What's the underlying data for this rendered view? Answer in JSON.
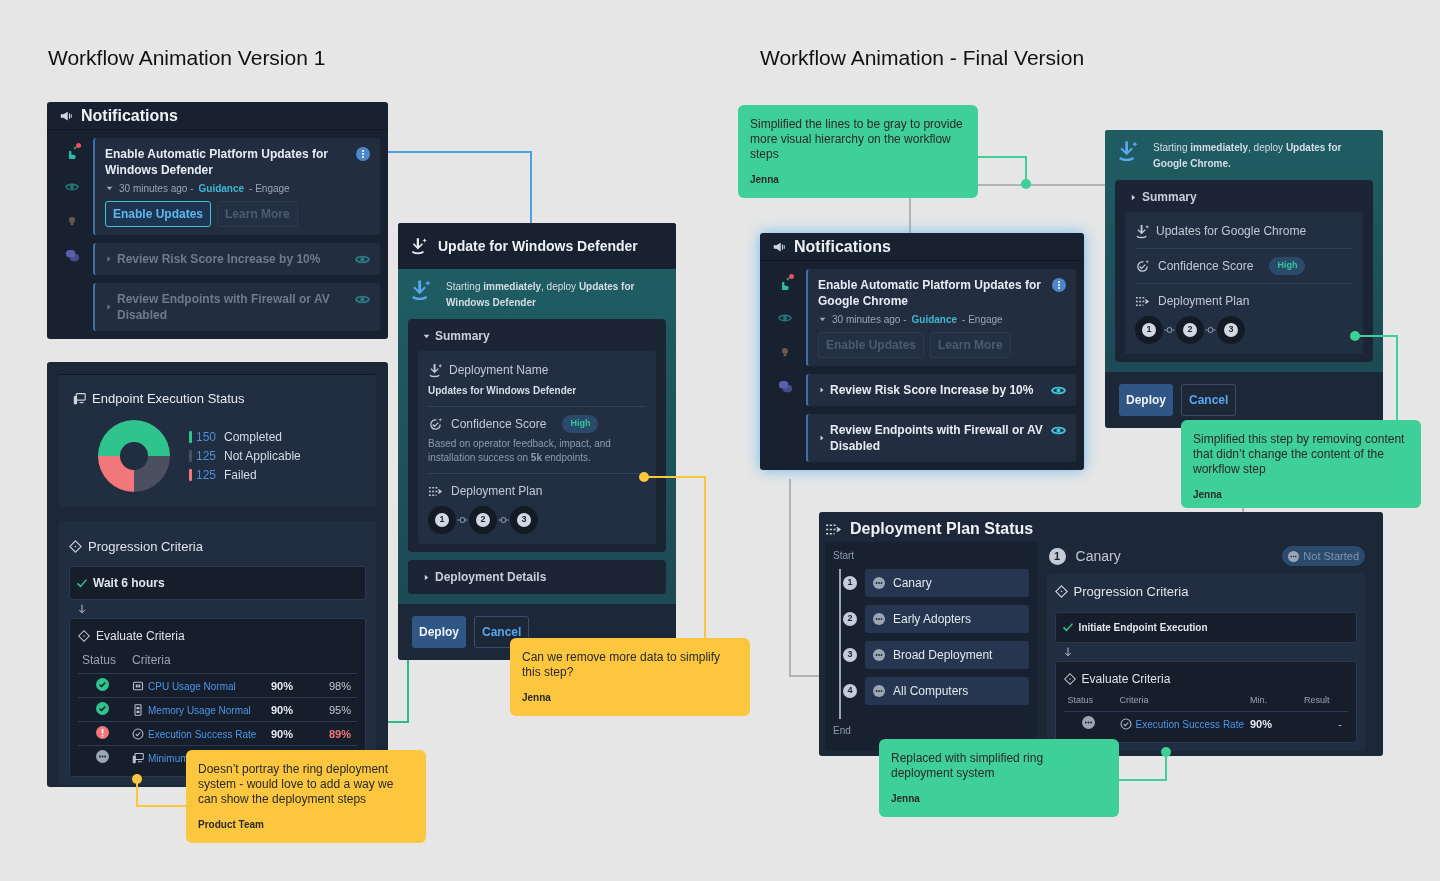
{
  "headings": [
    {
      "text": "Workflow Animation Version 1"
    },
    {
      "text": "Workflow Animation - Final Version"
    }
  ],
  "version_1": {
    "notifications": {
      "title": "Notifications",
      "items": [
        {
          "title": "Enable Automatic Platform Updates for Windows Defender",
          "expanded": true,
          "muted": false,
          "time": "30 minutes ago -",
          "category": "Guidance",
          "action": "- Engage",
          "buttons": [
            {
              "label": "Enable Updates",
              "disabled": false
            },
            {
              "label": "Learn More",
              "disabled": true
            }
          ]
        },
        {
          "title": "Review Risk Score Increase by 10%",
          "expanded": false,
          "muted": true
        },
        {
          "title": "Review Endpoints with Firewall or AV Disabled",
          "expanded": false,
          "muted": true
        }
      ]
    },
    "deployment": {
      "title": "Update for Windows Defender",
      "banner": "Starting **immediately**, deploy **Updates for Windows Defender**",
      "summary": {
        "label": "Summary",
        "expanded": true,
        "rows": [
          {
            "kind": "name",
            "label": "Deployment Name",
            "value": "Updates for Windows Defender"
          },
          {
            "kind": "score",
            "label": "Confidence Score",
            "badge": "High",
            "note": "Based on operator feedback, impact, and installation success on **5k** endpoints."
          },
          {
            "kind": "plan",
            "label": "Deployment Plan",
            "steps": [
              "1",
              "2",
              "3"
            ]
          }
        ]
      },
      "details": {
        "label": "Deployment Details",
        "expanded": false
      },
      "buttons": [
        "Deploy",
        "Cancel"
      ]
    },
    "execution": {
      "title": "Endpoint Execution Status",
      "chart_data": {
        "type": "donut",
        "categories": [
          "Completed",
          "Not Applicable",
          "Failed"
        ],
        "values": [
          50,
          25,
          25
        ]
      },
      "legend": [
        {
          "count": "150",
          "color": "#2fc48d"
        },
        {
          "count": "125",
          "color": "#4b5060"
        },
        {
          "count": "125",
          "color": "#f2777a"
        }
      ],
      "progression": {
        "title": "Progression Criteria",
        "wait": {
          "label": "Wait 6 hours",
          "checked": true
        },
        "evaluate": {
          "title": "Evaluate Criteria",
          "columns": [
            "Status",
            "Criteria"
          ],
          "rows": [
            {
              "kind": "pass",
              "criteria": "CPU Usage Normal",
              "min": "90%",
              "result": "98%"
            },
            {
              "kind": "pass",
              "criteria": "Memory Usage Normal",
              "min": "90%",
              "result": "95%"
            },
            {
              "kind": "fail",
              "criteria": "Execution Success Rate",
              "min": "90%",
              "result": "89%"
            },
            {
              "kind": "pending",
              "criteria": "Minimum"
            }
          ]
        }
      }
    }
  },
  "final_version": {
    "notifications": {
      "title": "Notifications",
      "items": [
        {
          "title": "Enable Automatic Platform Updates for Google Chrome",
          "expanded": true,
          "muted": false,
          "time": "30 minutes ago -",
          "category": "Guidance",
          "action": "- Engage",
          "buttons": [
            {
              "label": "Enable Updates",
              "disabled": true
            },
            {
              "label": "Learn More",
              "disabled": true
            }
          ]
        },
        {
          "title": "Review Risk Score Increase by 10%",
          "expanded": false,
          "muted": false
        },
        {
          "title": "Review Endpoints with Firewall or AV Disabled",
          "expanded": false,
          "muted": false
        }
      ]
    },
    "deployment": {
      "banner": "Starting **immediately**, deploy **Updates for Google Chrome.**",
      "summary": {
        "label": "Summary",
        "expanded": false,
        "rows": [
          {
            "kind": "name",
            "value": "Updates for Google Chrome"
          },
          {
            "kind": "score",
            "label": "Confidence Score",
            "badge": "High"
          },
          {
            "kind": "plan",
            "label": "Deployment Plan",
            "steps": [
              "1",
              "2",
              "3"
            ]
          }
        ]
      },
      "buttons": [
        "Deploy",
        "Cancel"
      ]
    },
    "plan_status": {
      "title": "Deployment Plan Status",
      "start": "Start",
      "end": "End",
      "rings": [
        {
          "number": "1",
          "name": "Canary"
        },
        {
          "number": "2",
          "name": "Early Adopters"
        },
        {
          "number": "3",
          "name": "Broad Deployment"
        },
        {
          "number": "4",
          "name": "All Computers"
        }
      ],
      "detail": {
        "number": "1",
        "name": "Canary",
        "status": "Not Started",
        "progression": {
          "title": "Progression Criteria",
          "wait": {
            "label": "Initiate Endpoint Execution",
            "checked": true
          },
          "evaluate": {
            "title": "Evaluate Criteria",
            "columns": [
              "Status",
              "Criteria",
              "Min.",
              "Result"
            ],
            "rows": [
              {
                "kind": "pending",
                "criteria": "Execution Success Rate",
                "min": "90%",
                "result": "-"
              }
            ]
          }
        }
      }
    }
  },
  "comments": [
    {
      "text": "Can we remove more data to simplify this step?",
      "author": "Jenna",
      "color": "#fcc63f"
    },
    {
      "text": "Doesn’t portray the ring deployment system - would love to add a way we can show the deployment steps",
      "author": "Product Team",
      "color": "#fcc63f"
    },
    {
      "text": "Simplified the lines to be gray to provide more visual hierarchy on the workflow steps",
      "author": "Jenna",
      "color": "#3fcf98"
    },
    {
      "text": "Simplified this step by removing content that didn’t change the content of the workflow step",
      "author": "Jenna",
      "color": "#3fcf98"
    },
    {
      "text": "Replaced with simplified ring deployment system",
      "author": "Jenna",
      "color": "#3fcf98"
    }
  ]
}
